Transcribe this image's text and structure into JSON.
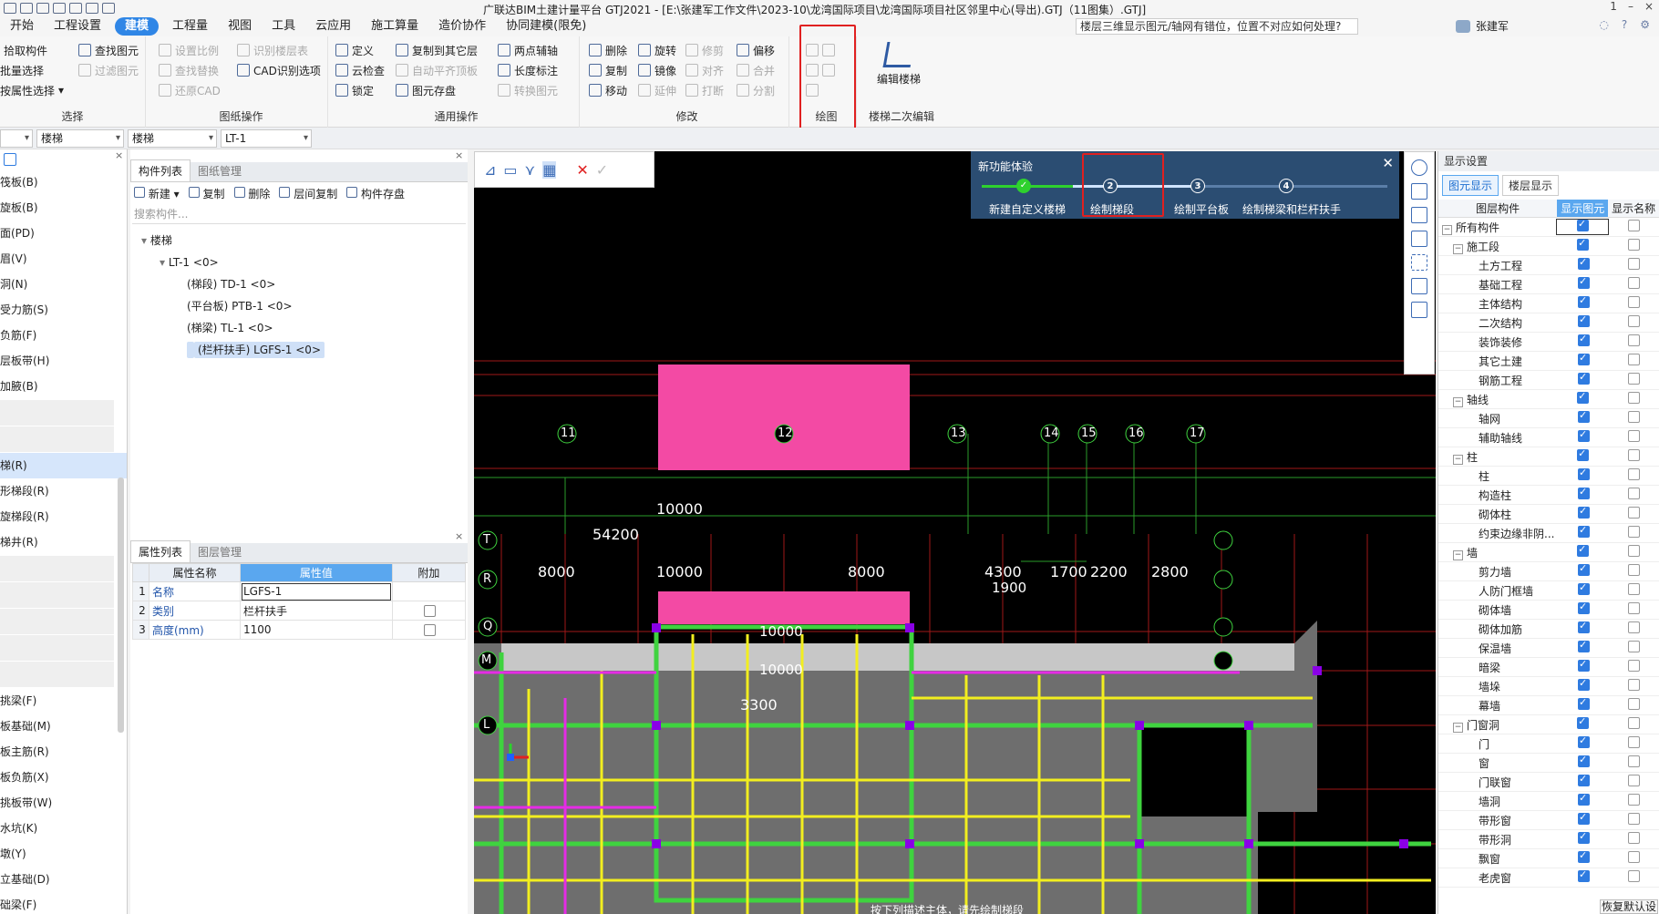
{
  "window_title": "广联达BIM土建计量平台 GTJ2021 - [E:\\张建军工作文件\\2023-10\\龙湾国际项目\\龙湾国际项目社区邻里中心(导出).GTJ（11图集）.GTJ]",
  "window_controls": [
    "1",
    "–",
    "×"
  ],
  "menus": [
    "开始",
    "工程设置",
    "建模",
    "工程量",
    "视图",
    "工具",
    "云应用",
    "施工算量",
    "造价协作",
    "协同建模(限免)"
  ],
  "active_menu": "建模",
  "help_search": "楼层三维显示图元/轴网有错位，位置不对应如何处理?",
  "user_name": "张建军",
  "ribbon": {
    "select": {
      "label": "选择",
      "buttons": [
        "拾取构件",
        "查找图元",
        "批量选择",
        "过滤图元",
        "按属性选择"
      ]
    },
    "drawing_ops": {
      "label": "图纸操作",
      "buttons": [
        "设置比例",
        "识别楼层表",
        "查找替换",
        "CAD识别选项",
        "还原CAD"
      ]
    },
    "general_ops": {
      "label": "通用操作",
      "buttons": [
        "定义",
        "复制到其它层",
        "两点辅轴",
        "云检查",
        "自动平齐顶板",
        "长度标注",
        "锁定",
        "图元存盘",
        "转换图元"
      ]
    },
    "modify": {
      "label": "修改",
      "buttons": [
        "删除",
        "旋转",
        "修剪",
        "偏移",
        "复制",
        "镜像",
        "对齐",
        "合并",
        "移动",
        "延伸",
        "打断",
        "分割"
      ]
    },
    "draw": {
      "label": "绘图"
    },
    "stair_edit": {
      "label": "楼梯二次编辑",
      "button": "编辑楼梯"
    }
  },
  "prop_bar": {
    "combo1": "",
    "combo2": "楼梯",
    "combo3": "楼梯",
    "combo4": "LT-1"
  },
  "left_nav": [
    "筏板(B)",
    "旋板(B)",
    "面(PD)",
    "眉(V)",
    "洞(N)",
    "受力筋(S)",
    "负筋(F)",
    "层板带(H)",
    "加腋(B)",
    "",
    "",
    "梯(R)",
    "形梯段(R)",
    "旋梯段(R)",
    "梯井(R)",
    "",
    "",
    "",
    "",
    "",
    "挑梁(F)",
    "板基础(M)",
    "板主筋(R)",
    "板负筋(X)",
    "挑板带(W)",
    "水坑(K)",
    "墩(Y)",
    "立基础(D)",
    "础梁(F)"
  ],
  "left_nav_selected": "梯(R)",
  "component_list": {
    "tabs": [
      "构件列表",
      "图纸管理"
    ],
    "toolbar": [
      "新建",
      "复制",
      "删除",
      "层间复制",
      "构件存盘"
    ],
    "search_placeholder": "搜索构件...",
    "tree": [
      {
        "text": "楼梯",
        "level": 0
      },
      {
        "text": "LT-1 <0>",
        "level": 1
      },
      {
        "text": "(梯段) TD-1 <0>",
        "level": 2
      },
      {
        "text": "(平台板) PTB-1 <0>",
        "level": 2
      },
      {
        "text": "(梯梁) TL-1 <0>",
        "level": 2
      },
      {
        "text": "(栏杆扶手) LGFS-1 <0>",
        "level": 2
      }
    ],
    "selected": "(栏杆扶手) LGFS-1 <0>"
  },
  "property_list": {
    "tabs": [
      "属性列表",
      "图层管理"
    ],
    "headers": [
      "属性名称",
      "属性值",
      "附加"
    ],
    "rows": [
      {
        "idx": "1",
        "name": "名称",
        "value": "LGFS-1",
        "extra": false
      },
      {
        "idx": "2",
        "name": "类别",
        "value": "栏杆扶手",
        "extra": true
      },
      {
        "idx": "3",
        "name": "高度(mm)",
        "value": "1100",
        "extra": true
      }
    ]
  },
  "wizard": {
    "title": "新功能体验",
    "steps": [
      {
        "num": "✓",
        "label": "新建自定义楼梯"
      },
      {
        "num": "2",
        "label": "绘制梯段"
      },
      {
        "num": "3",
        "label": "绘制平台板"
      },
      {
        "num": "4",
        "label": "绘制梯梁和栏杆扶手"
      }
    ]
  },
  "canvas": {
    "axes_top": [
      "11",
      "12",
      "13",
      "14",
      "15",
      "16",
      "17"
    ],
    "axes_left": [
      "T",
      "R",
      "Q",
      "M",
      "L"
    ],
    "dimensions": [
      "10000",
      "54200",
      "8000",
      "10000",
      "8000",
      "4300",
      "1700",
      "2200",
      "2800",
      "1900",
      "10000",
      "10000",
      "3300"
    ],
    "status_text": "按下列描述主体，请先绘制梯段"
  },
  "display_settings": {
    "title": "显示设置",
    "tabs": [
      "图元显示",
      "楼层显示"
    ],
    "headers": [
      "图层构件",
      "显示图元",
      "显示名称"
    ],
    "rows": [
      {
        "name": "所有构件",
        "level": 0,
        "group": true,
        "show": true,
        "name_show": false
      },
      {
        "name": "施工段",
        "level": 1,
        "group": true,
        "show": true,
        "name_show": false
      },
      {
        "name": "土方工程",
        "level": 2,
        "show": true,
        "name_show": false
      },
      {
        "name": "基础工程",
        "level": 2,
        "show": true,
        "name_show": false
      },
      {
        "name": "主体结构",
        "level": 2,
        "show": true,
        "name_show": false
      },
      {
        "name": "二次结构",
        "level": 2,
        "show": true,
        "name_show": false
      },
      {
        "name": "装饰装修",
        "level": 2,
        "show": true,
        "name_show": false
      },
      {
        "name": "其它土建",
        "level": 2,
        "show": true,
        "name_show": false
      },
      {
        "name": "钢筋工程",
        "level": 2,
        "show": true,
        "name_show": false
      },
      {
        "name": "轴线",
        "level": 1,
        "group": true,
        "show": true,
        "name_show": false
      },
      {
        "name": "轴网",
        "level": 2,
        "show": true,
        "name_show": false
      },
      {
        "name": "辅助轴线",
        "level": 2,
        "show": true,
        "name_show": false
      },
      {
        "name": "柱",
        "level": 1,
        "group": true,
        "show": true,
        "name_show": false
      },
      {
        "name": "柱",
        "level": 2,
        "show": true,
        "name_show": false
      },
      {
        "name": "构造柱",
        "level": 2,
        "show": true,
        "name_show": false
      },
      {
        "name": "砌体柱",
        "level": 2,
        "show": true,
        "name_show": false
      },
      {
        "name": "约束边缘非阴...",
        "level": 2,
        "show": true,
        "name_show": false
      },
      {
        "name": "墙",
        "level": 1,
        "group": true,
        "show": true,
        "name_show": false
      },
      {
        "name": "剪力墙",
        "level": 2,
        "show": true,
        "name_show": false
      },
      {
        "name": "人防门框墙",
        "level": 2,
        "show": true,
        "name_show": false
      },
      {
        "name": "砌体墙",
        "level": 2,
        "show": true,
        "name_show": false
      },
      {
        "name": "砌体加筋",
        "level": 2,
        "show": true,
        "name_show": false
      },
      {
        "name": "保温墙",
        "level": 2,
        "show": true,
        "name_show": false
      },
      {
        "name": "暗梁",
        "level": 2,
        "show": true,
        "name_show": false
      },
      {
        "name": "墙垛",
        "level": 2,
        "show": true,
        "name_show": false
      },
      {
        "name": "幕墙",
        "level": 2,
        "show": true,
        "name_show": false
      },
      {
        "name": "门窗洞",
        "level": 1,
        "group": true,
        "show": true,
        "name_show": false
      },
      {
        "name": "门",
        "level": 2,
        "show": true,
        "name_show": false
      },
      {
        "name": "窗",
        "level": 2,
        "show": true,
        "name_show": false
      },
      {
        "name": "门联窗",
        "level": 2,
        "show": true,
        "name_show": false
      },
      {
        "name": "墙洞",
        "level": 2,
        "show": true,
        "name_show": false
      },
      {
        "name": "带形窗",
        "level": 2,
        "show": true,
        "name_show": false
      },
      {
        "name": "带形洞",
        "level": 2,
        "show": true,
        "name_show": false
      },
      {
        "name": "飘窗",
        "level": 2,
        "show": true,
        "name_show": false
      },
      {
        "name": "老虎窗",
        "level": 2,
        "show": true,
        "name_show": false
      }
    ],
    "restore_button": "恢复默认设"
  }
}
